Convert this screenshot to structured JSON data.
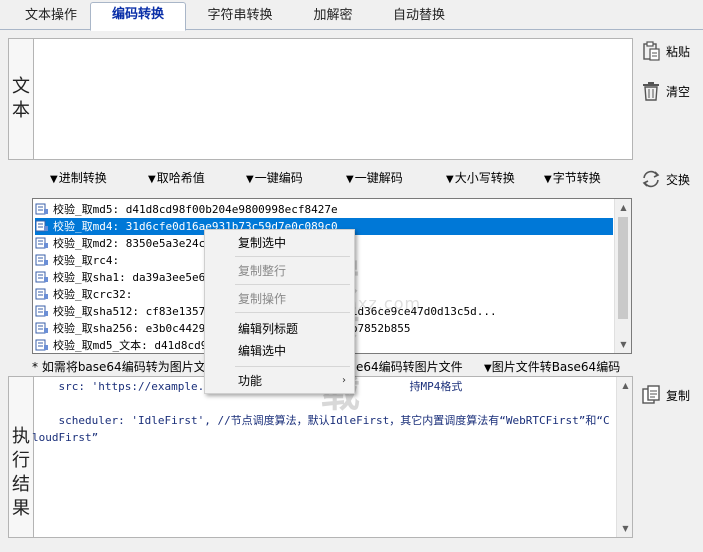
{
  "tabs": [
    {
      "label": "文本操作",
      "active": false
    },
    {
      "label": "编码转换",
      "active": true
    },
    {
      "label": "字符串转换",
      "active": false
    },
    {
      "label": "加解密",
      "active": false
    },
    {
      "label": "自动替换",
      "active": false
    }
  ],
  "text_panel": {
    "label": "文本",
    "value": ""
  },
  "side_buttons": {
    "paste": "粘贴",
    "clear": "清空",
    "swap": "交换",
    "copy": "复制"
  },
  "toolbar": [
    {
      "label": "进制转换"
    },
    {
      "label": "取哈希值"
    },
    {
      "label": "一键编码"
    },
    {
      "label": "一键解码"
    },
    {
      "label": "大小写转换"
    },
    {
      "label": "字节转换"
    }
  ],
  "hash_list": [
    {
      "text": "校验_取md5: d41d8cd98f00b204e9800998ecf8427e",
      "selected": false
    },
    {
      "text": "校验_取md4: 31d6cfe0d16ae931b73c59d7e0c089c0",
      "selected": true
    },
    {
      "text": "校验_取md2: 8350e5a3e24c1",
      "selected": false
    },
    {
      "text": "校验_取rc4:",
      "selected": false
    },
    {
      "text": "校验_取sha1: da39a3ee5e6b                                    709",
      "selected": false
    },
    {
      "text": "校验_取crc32:",
      "selected": false
    },
    {
      "text": "校验_取sha512: cf83e1357e                                 0e4050b5715dc83f4a921d36ce9ce47d0d13c5d...",
      "selected": false
    },
    {
      "text": "校验_取sha256: e3b0c44298                                 e41e4649b934ca495991b7852b855",
      "selected": false
    },
    {
      "text": "校验_取md5_文本: d41d8cd9",
      "selected": false
    }
  ],
  "base64_bar": {
    "hint": "* 如需将base64编码转为图片文件",
    "btn_b64_to_img": "e64编码转图片文件",
    "btn_img_to_b64": "图片文件转Base64编码"
  },
  "result_panel": {
    "label": "执行结果",
    "line1": "    src: 'https://example.mp4',                          持MP4格式",
    "line2": "",
    "line3": "    scheduler: 'IdleFirst', //节点调度算法，默认IdleFirst，其它内置调度算法有“WebRTCFirst”和“CloudFirst”"
  },
  "context_menu": {
    "items": [
      {
        "label": "复制选中",
        "disabled": false
      },
      {
        "label": "复制整行",
        "disabled": true
      },
      {
        "label": "复制操作",
        "disabled": true
      },
      {
        "label": "编辑列标题",
        "disabled": false
      },
      {
        "label": "编辑选中",
        "disabled": false
      },
      {
        "label": "功能",
        "disabled": false,
        "submenu": true
      }
    ],
    "submenu_glyph": "›"
  },
  "watermark": {
    "text": "安下载",
    "url": "anxz.com"
  },
  "glyphs": {
    "dropdown": "▼"
  }
}
